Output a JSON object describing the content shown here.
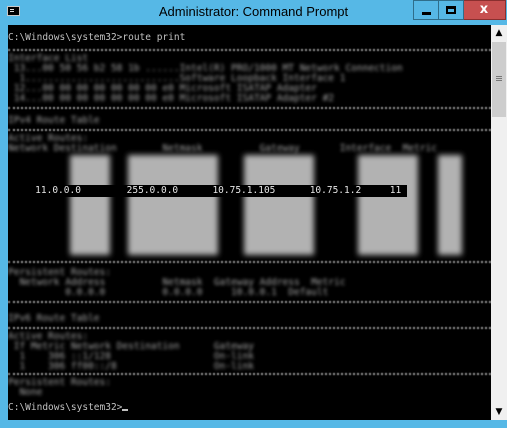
{
  "window": {
    "title": "Administrator: Command Prompt",
    "minimize_glyph": "▁",
    "close_glyph": "x"
  },
  "console": {
    "command_line": "C:\\Windows\\system32>route print",
    "interface_lines": [
      "Interface List",
      " 13...00 50 56 b2 58 1b ......Intel(R) PRO/1000 MT Network Connection",
      "  1...........................Software Loopback Interface 1",
      " 12...00 00 00 00 00 00 00 e0 Microsoft ISATAP Adapter",
      " 14...00 00 00 00 00 00 00 e0 Microsoft ISATAP Adapter #2"
    ],
    "ipv4_header": "IPv4 Route Table",
    "active_routes": "Active Routes:",
    "route_columns": "Network Destination        Netmask          Gateway       Interface  Metric",
    "highlighted_route": "   11.0.0.0        255.0.0.0      10.75.1.105      10.75.1.2     11",
    "persistent_routes": "Persistent Routes:",
    "persistent_columns": "  Network Address          Netmask  Gateway Address  Metric",
    "persistent_row": "          0.0.0.0          0.0.0.0     10.0.0.1  Default",
    "ipv6_header": "IPv6 Route Table",
    "ipv6_active": "Active Routes:",
    "ipv6_columns": " If Metric Network Destination      Gateway",
    "ipv6_rows": [
      "  1    306 ::1/128                  On-link",
      "  1    306 ff00::/8                 On-link"
    ],
    "ipv6_persistent": "Persistent Routes:",
    "ipv6_none": "  None",
    "prompt": "C:\\Windows\\system32>"
  },
  "scrollbar": {
    "up_arrow": "▲",
    "down_arrow": "▼"
  }
}
